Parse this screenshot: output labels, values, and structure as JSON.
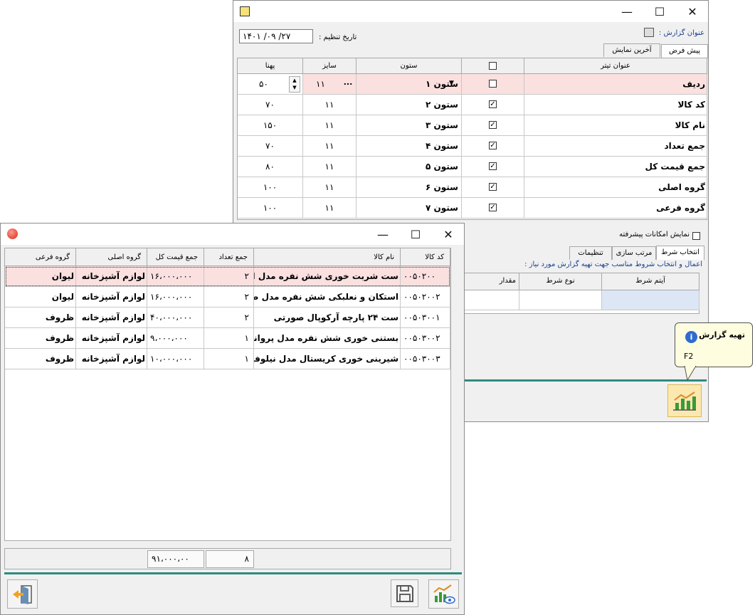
{
  "settings": {
    "report_title_label": "عنوان گزارش :",
    "date_label": "تاریخ تنظیم :",
    "date_value": "۱۴۰۱ /۰۹ /۲۷",
    "tab_default": "پیش فرض",
    "tab_last": "آخرین نمایش",
    "headers": {
      "title": "عنوان تیتر",
      "column": "ستون",
      "size": "سایز",
      "width": "پهنا"
    },
    "rows": [
      {
        "title": "ردیف",
        "column": "ستون ۱",
        "checked": false,
        "size": "۱۱",
        "width": "۵۰"
      },
      {
        "title": "کد کالا",
        "column": "ستون ۲",
        "checked": true,
        "size": "۱۱",
        "width": "۷۰"
      },
      {
        "title": "نام کالا",
        "column": "ستون ۳",
        "checked": true,
        "size": "۱۱",
        "width": "۱۵۰"
      },
      {
        "title": "جمع تعداد",
        "column": "ستون ۴",
        "checked": true,
        "size": "۱۱",
        "width": "۷۰"
      },
      {
        "title": "جمع قیمت کل",
        "column": "ستون ۵",
        "checked": true,
        "size": "۱۱",
        "width": "۸۰"
      },
      {
        "title": "گروه اصلی",
        "column": "ستون ۶",
        "checked": true,
        "size": "۱۱",
        "width": "۱۰۰"
      },
      {
        "title": "گروه فرعی",
        "column": "ستون ۷",
        "checked": true,
        "size": "۱۱",
        "width": "۱۰۰"
      }
    ],
    "advanced_label": "نمایش امکانات پیشرفته",
    "tab_condition": "انتخاب شرط",
    "tab_sort": "مرتب سازی",
    "tab_settings": "تنظیمات",
    "condition_hint": "اعمال و انتخاب شروط مناسب جهت تهیه گزارش  مورد نیاز :",
    "cond_headers": {
      "item": "آیتم شرط",
      "type": "نوع شرط",
      "value": "مقدار"
    },
    "tooltip_title": "تهیه گزارش",
    "tooltip_key": "F2"
  },
  "report": {
    "headers": [
      "کد کالا",
      "نام کالا",
      "جمع تعداد",
      "جمع قیمت کل",
      "گروه اصلی",
      "گروه فرعی"
    ],
    "rows": [
      [
        "۰۰۵۰۲۰۰",
        "ست شربت خوری شش نفره مدل الماس",
        "۲",
        "۱۶،۰۰۰،۰۰۰",
        "لوازم آشپزخانه",
        "لیوان"
      ],
      [
        "۰۰۵۰۲۰۰۲",
        "استکان و نعلبکی شش نفره مدل صدف",
        "۲",
        "۱۶،۰۰۰،۰۰۰",
        "لوازم آشپزخانه",
        "لیوان"
      ],
      [
        "۰۰۵۰۳۰۰۱",
        "ست ۲۴ پارچه آرکوپال صورتی",
        "۲",
        "۴۰،۰۰۰،۰۰۰",
        "لوازم آشپزخانه",
        "ظروف"
      ],
      [
        "۰۰۵۰۳۰۰۲",
        "بستنی خوری شش نفره مدل پروانه",
        "۱",
        "۹،۰۰۰،۰۰۰",
        "لوازم آشپزخانه",
        "ظروف"
      ],
      [
        "۰۰۵۰۳۰۰۳",
        "شیرینی خوری کریستال مدل نیلوفر",
        "۱",
        "۱۰،۰۰۰،۰۰۰",
        "لوازم آشپزخانه",
        "ظروف"
      ]
    ],
    "total_qty": "۸",
    "total_price": "۹۱،۰۰۰،۰۰"
  },
  "colors": {
    "accent": "#2e8b80",
    "highlight": "#fbe0e0",
    "link": "#1a3f8f"
  }
}
